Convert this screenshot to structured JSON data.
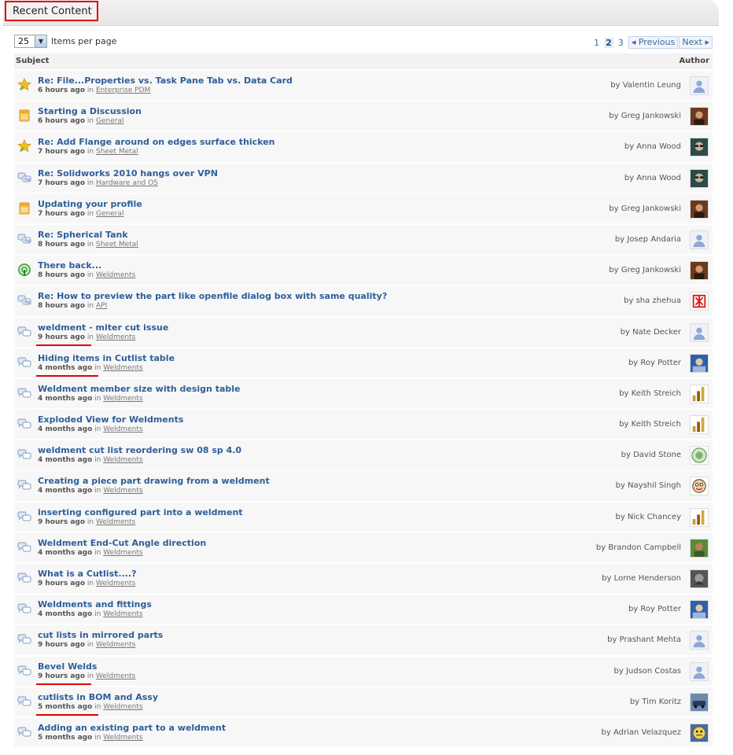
{
  "section": {
    "title": "Recent Content"
  },
  "toolbar": {
    "per_page_value": "25",
    "per_page_label": "Items per page"
  },
  "pager": {
    "pages": [
      "1",
      "2",
      "3"
    ],
    "current": "2",
    "prev_label": "◂ Previous",
    "next_label": "Next ▸"
  },
  "columns": {
    "subject": "Subject",
    "author": "Author"
  },
  "colors": {
    "accent": "#2e5e99",
    "highlight": "#e00000",
    "row_bg": "#f7f7f7"
  },
  "rows": [
    {
      "icon": "star-icon",
      "title": "Re: File...Properties  vs. Task Pane Tab vs. Data Card",
      "time": "6 hours ago",
      "in": "in",
      "category": "Enterprise PDM",
      "author": "by Valentin Leung",
      "avatar": "default",
      "highlight": false
    },
    {
      "icon": "document-icon",
      "title": "Starting a Discussion",
      "time": "6 hours ago",
      "in": "in",
      "category": "General",
      "author": "by Greg Jankowski",
      "avatar": "photo-brown",
      "highlight": false
    },
    {
      "icon": "star-icon",
      "title": "Re: Add Flange around on edges surface thicken",
      "time": "7 hours ago",
      "in": "in",
      "category": "Sheet Metal",
      "author": "by Anna Wood",
      "avatar": "photo-glasses",
      "highlight": false
    },
    {
      "icon": "reply-bubbles-icon",
      "title": "Re: Solidworks 2010 hangs over VPN",
      "time": "7 hours ago",
      "in": "in",
      "category": "Hardware and OS",
      "author": "by Anna Wood",
      "avatar": "photo-glasses",
      "highlight": false
    },
    {
      "icon": "document-icon",
      "title": "Updating your profile",
      "time": "7 hours ago",
      "in": "in",
      "category": "General",
      "author": "by Greg Jankowski",
      "avatar": "photo-brown",
      "highlight": false
    },
    {
      "icon": "reply-bubbles-icon",
      "title": "Re: Spherical Tank",
      "time": "8 hours ago",
      "in": "in",
      "category": "Sheet Metal",
      "author": "by Josep Andaria",
      "avatar": "default",
      "highlight": false
    },
    {
      "icon": "broadcast-icon",
      "title": "There back...",
      "time": "8 hours ago",
      "in": "in",
      "category": "Weldments",
      "author": "by Greg Jankowski",
      "avatar": "photo-brown",
      "highlight": false
    },
    {
      "icon": "reply-bubbles-icon",
      "title": "Re: How to preview the part like openfile dialog box with same quality?",
      "time": "8 hours ago",
      "in": "in",
      "category": "API",
      "author": "by sha zhehua",
      "avatar": "red-glyph",
      "highlight": false
    },
    {
      "icon": "bubbles-icon",
      "title": "weldment - miter cut issue",
      "time": "9 hours ago",
      "in": "in",
      "category": "Weldments",
      "author": "by Nate Decker",
      "avatar": "default",
      "highlight": true
    },
    {
      "icon": "bubbles-icon",
      "title": "Hiding items in Cutlist table",
      "time": "4 months ago",
      "in": "in",
      "category": "Weldments",
      "author": "by Roy Potter",
      "avatar": "photo-blue",
      "highlight": true
    },
    {
      "icon": "bubbles-icon",
      "title": "Weldment member size with design table",
      "time": "4 months ago",
      "in": "in",
      "category": "Weldments",
      "author": "by Keith Streich",
      "avatar": "bars-icon",
      "highlight": false
    },
    {
      "icon": "bubbles-icon",
      "title": "Exploded View for Weldments",
      "time": "4 months ago",
      "in": "in",
      "category": "Weldments",
      "author": "by Keith Streich",
      "avatar": "bars-icon",
      "highlight": false
    },
    {
      "icon": "bubbles-icon",
      "title": "weldment cut list reordering sw 08 sp 4.0",
      "time": "4 months ago",
      "in": "in",
      "category": "Weldments",
      "author": "by David Stone",
      "avatar": "green-circle",
      "highlight": false
    },
    {
      "icon": "bubbles-icon",
      "title": "Creating a piece part drawing from a weldment",
      "time": "4 months ago",
      "in": "in",
      "category": "Weldments",
      "author": "by Nayshil Singh",
      "avatar": "cartoon-face",
      "highlight": false
    },
    {
      "icon": "bubbles-icon",
      "title": "inserting configured part into a weldment",
      "time": "9 hours ago",
      "in": "in",
      "category": "Weldments",
      "author": "by Nick Chancey",
      "avatar": "bars-icon",
      "highlight": false
    },
    {
      "icon": "bubbles-icon",
      "title": "Weldment End-Cut Angle direction",
      "time": "4 months ago",
      "in": "in",
      "category": "Weldments",
      "author": "by Brandon Campbell",
      "avatar": "photo-green",
      "highlight": false
    },
    {
      "icon": "bubbles-icon",
      "title": "What is a Cutlist....?",
      "time": "9 hours ago",
      "in": "in",
      "category": "Weldments",
      "author": "by Lorne Henderson",
      "avatar": "photo-dark",
      "highlight": false
    },
    {
      "icon": "bubbles-icon",
      "title": "Weldments and fittings",
      "time": "4 months ago",
      "in": "in",
      "category": "Weldments",
      "author": "by Roy Potter",
      "avatar": "photo-blue",
      "highlight": false
    },
    {
      "icon": "bubbles-icon",
      "title": "cut lists in mirrored parts",
      "time": "9 hours ago",
      "in": "in",
      "category": "Weldments",
      "author": "by Prashant Mehta",
      "avatar": "default",
      "highlight": false
    },
    {
      "icon": "bubbles-icon",
      "title": "Bevel Welds",
      "time": "9 hours ago",
      "in": "in",
      "category": "Weldments",
      "author": "by Judson Costas",
      "avatar": "default",
      "highlight": true
    },
    {
      "icon": "bubbles-icon",
      "title": "cutlists in BOM and Assy",
      "time": "5 months ago",
      "in": "in",
      "category": "Weldments",
      "author": "by Tim Koritz",
      "avatar": "photo-car",
      "highlight": true
    },
    {
      "icon": "bubbles-icon",
      "title": "Adding an existing part to a weldment",
      "time": "5 months ago",
      "in": "in",
      "category": "Weldments",
      "author": "by Adrian Velazquez",
      "avatar": "cartoon-yellow",
      "highlight": false
    }
  ]
}
